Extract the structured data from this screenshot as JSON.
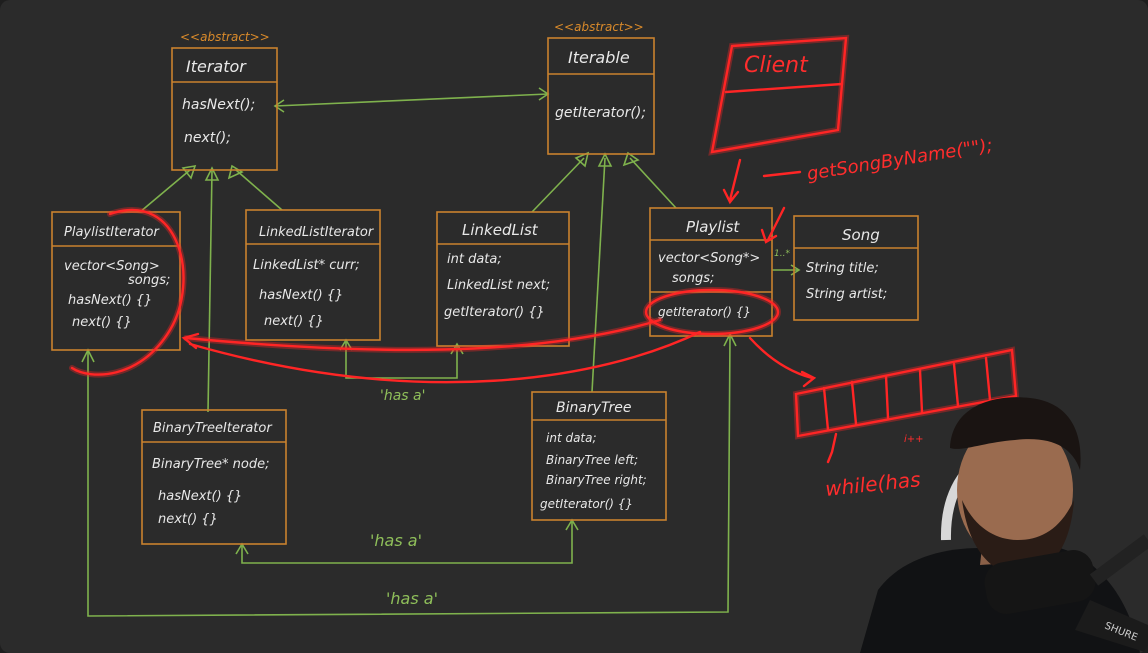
{
  "stereotype_iterator": "<<abstract>>",
  "stereotype_iterable": "<<abstract>>",
  "iterator": {
    "title": "Iterator",
    "members": [
      "hasNext();",
      "next();"
    ]
  },
  "iterable": {
    "title": "Iterable",
    "members": [
      "getIterator();"
    ]
  },
  "playlist_iterator": {
    "title": "PlaylistIterator",
    "members": [
      "vector<Song>",
      "songs;",
      "hasNext() {}",
      "next() {}"
    ]
  },
  "linkedlist_iterator": {
    "title": "LinkedListIterator",
    "members": [
      "LinkedList* curr;",
      "hasNext() {}",
      "next() {}"
    ]
  },
  "linkedlist": {
    "title": "LinkedList",
    "members": [
      "int data;",
      "LinkedList next;",
      "getIterator() {}"
    ]
  },
  "playlist": {
    "title": "Playlist",
    "members": [
      "vector<Song*>",
      "songs;",
      "getIterator() {}"
    ]
  },
  "song": {
    "title": "Song",
    "members": [
      "String title;",
      "String artist;"
    ]
  },
  "binarytree_iterator": {
    "title": "BinaryTreeIterator",
    "members": [
      "BinaryTree* node;",
      "hasNext() {}",
      "next() {}"
    ]
  },
  "binarytree": {
    "title": "BinaryTree",
    "members": [
      "int data;",
      "BinaryTree left;",
      "BinaryTree right;",
      "getIterator() {}"
    ]
  },
  "client": {
    "title": "Client"
  },
  "annotations": {
    "get_song": "getSongByName(\"\");",
    "multiplicity": "1..*",
    "has_a_1": "'has a'",
    "has_a_2": "'has a'",
    "has_a_3": "'has a'",
    "while": "while(has",
    "while_sup": "i++"
  },
  "colors": {
    "background": "#2b2b2b",
    "box": "#c9822e",
    "arrow": "#7fb24d",
    "pen": "#ff2525",
    "text": "#e8e8e8"
  }
}
